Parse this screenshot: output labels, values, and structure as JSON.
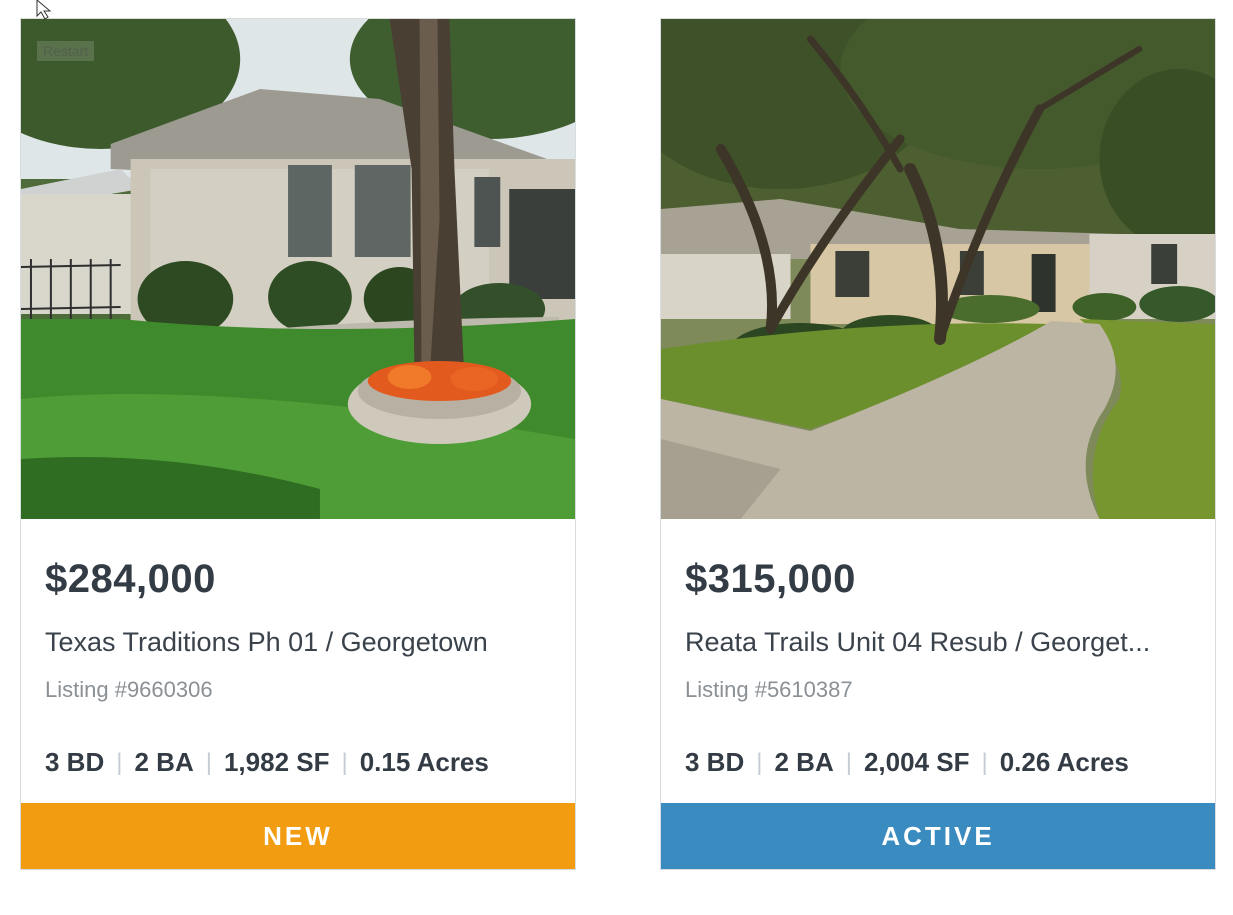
{
  "overlay": {
    "restart_label": "Restart"
  },
  "listings": [
    {
      "price": "$284,000",
      "title": "Texas Traditions Ph 01 / Georgetown",
      "listing_number": "Listing #9660306",
      "beds": "3 BD",
      "baths": "2 BA",
      "sqft": "1,982 SF",
      "acres": "0.15 Acres",
      "status": "NEW",
      "status_color": "#f29c12",
      "photo": "house-with-tree-photo"
    },
    {
      "price": "$315,000",
      "title": "Reata Trails Unit 04 Resub / Georget...",
      "listing_number": "Listing #5610387",
      "beds": "3 BD",
      "baths": "2 BA",
      "sqft": "2,004 SF",
      "acres": "0.26 Acres",
      "status": "ACTIVE",
      "status_color": "#3a8bbf",
      "photo": "house-with-oak-trees-photo"
    }
  ]
}
